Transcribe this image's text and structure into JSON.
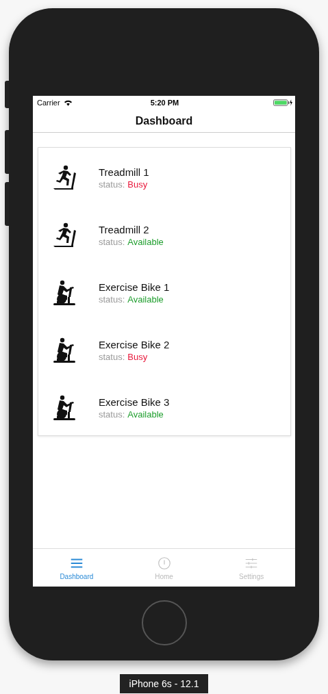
{
  "status_bar": {
    "carrier": "Carrier",
    "time": "5:20 PM"
  },
  "nav": {
    "title": "Dashboard"
  },
  "equipment": [
    {
      "kind": "treadmill",
      "name": "Treadmill 1",
      "status_label": "status:",
      "status": "Busy",
      "busy": true
    },
    {
      "kind": "treadmill",
      "name": "Treadmill 2",
      "status_label": "status:",
      "status": "Available",
      "busy": false
    },
    {
      "kind": "bike",
      "name": "Exercise Bike 1",
      "status_label": "status:",
      "status": "Available",
      "busy": false
    },
    {
      "kind": "bike",
      "name": "Exercise Bike 2",
      "status_label": "status:",
      "status": "Busy",
      "busy": true
    },
    {
      "kind": "bike",
      "name": "Exercise Bike 3",
      "status_label": "status:",
      "status": "Available",
      "busy": false
    }
  ],
  "tabs": [
    {
      "kind": "menu",
      "label": "Dashboard",
      "selected": true
    },
    {
      "kind": "home",
      "label": "Home",
      "selected": false
    },
    {
      "kind": "settings",
      "label": "Settings",
      "selected": false
    }
  ],
  "device_label": "iPhone 6s - 12.1"
}
